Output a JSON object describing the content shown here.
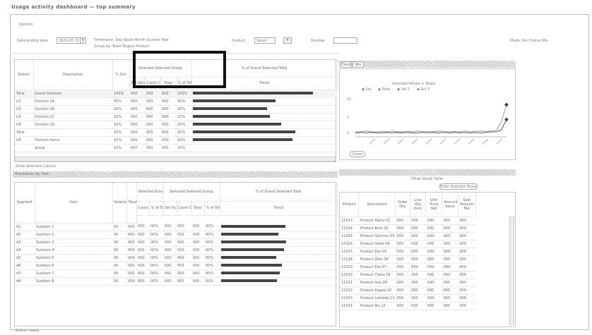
{
  "app": {
    "title": "Usage activity dashboard — top summary"
  },
  "filters": {
    "section_label": "Options",
    "date_label": "Data ending date",
    "date_value": "2021-05-31",
    "radio_row1": "Timeframe: Day  Week  Month  Quarter  Year",
    "radio_row2": "Group by: Team  Region  Product",
    "product_label": "Product",
    "product_value": "Select",
    "number_label": "Number",
    "number_value": "",
    "right_note": "Mode: Per Choice Mix"
  },
  "summary_table": {
    "headers": {
      "col_code": "School",
      "col_desc": "Description",
      "col_pct": "% Sch",
      "group_top": "Selected Selected Group",
      "col_sel": "Sel Values",
      "col_count": "Count Count",
      "col_total": "Total",
      "col_pctof": "% of Total",
      "group_right": "% of Grand Selected Total",
      "col_trend": "Trend"
    },
    "rows": [
      {
        "code": "Total",
        "desc": "Grand Subtotal",
        "pct": "100%",
        "a": "000",
        "b": "000",
        "c": "000",
        "d": "100%",
        "bar": 84
      },
      {
        "code": "U1",
        "desc": "Division 1A",
        "pct": "45%",
        "a": "000",
        "b": "000",
        "c": "000",
        "d": "45%",
        "bar": 58
      },
      {
        "code": "U2",
        "desc": "Division 1B",
        "pct": "20%",
        "a": "000",
        "b": "000",
        "c": "000",
        "d": "20%",
        "bar": 52
      },
      {
        "code": "U3",
        "desc": "Division 1C",
        "pct": "15%",
        "a": "000",
        "b": "000",
        "c": "000",
        "d": "15%",
        "bar": 54
      },
      {
        "code": "U4",
        "desc": "Division 1D",
        "pct": "10%",
        "a": "000",
        "b": "000",
        "c": "000",
        "d": "10%",
        "bar": 62
      },
      {
        "code": "Total",
        "desc": "",
        "pct": "10%",
        "a": "000",
        "b": "000",
        "c": "000",
        "d": "10%",
        "bar": 72
      },
      {
        "code": "U5",
        "desc": "Division Items",
        "pct": "10%",
        "a": "000",
        "b": "000",
        "c": "000",
        "d": "10%",
        "bar": 70
      },
      {
        "code": "",
        "desc": "group",
        "pct": "10%",
        "a": "000",
        "b": "000",
        "c": "000",
        "d": "10%",
        "bar": 0
      }
    ],
    "footer_note": "Show Selected Column"
  },
  "detail_table": {
    "section_title": "Breakdown by item",
    "headers": {
      "col_code": "Segment",
      "col_item": "Item",
      "col_sel": "Selected Sel Count",
      "col_total": "Total",
      "col_count": "Count",
      "group_mid": "Selected Group",
      "col_pct": "% of Total",
      "col_v1": "Sel Values",
      "col_v2": "Count Count",
      "col_v3": "Total",
      "col_v4": "% of Total",
      "group_top": "Selected Selected Group",
      "group_right": "% of Grand Selected Total",
      "col_trend": "Trend"
    },
    "rows": [
      {
        "code": "A1",
        "item": "Subitem 1",
        "s": "00",
        "t": "000",
        "c": "000",
        "p": "00%",
        "v1": "000",
        "v2": "000",
        "v3": "000",
        "v4": "00%",
        "bar": 56
      },
      {
        "code": "A2",
        "item": "Subitem 2",
        "s": "00",
        "t": "000",
        "c": "000",
        "p": "00%",
        "v1": "000",
        "v2": "000",
        "v3": "000",
        "v4": "00%",
        "bar": 50
      },
      {
        "code": "A3",
        "item": "Subitem 3",
        "s": "00",
        "t": "000",
        "c": "000",
        "p": "00%",
        "v1": "000",
        "v2": "000",
        "v3": "000",
        "v4": "00%",
        "bar": 57
      },
      {
        "code": "A4",
        "item": "Subitem 4",
        "s": "00",
        "t": "000",
        "c": "000",
        "p": "00%",
        "v1": "000",
        "v2": "000",
        "v3": "000",
        "v4": "00%",
        "bar": 55
      },
      {
        "code": "A5",
        "item": "Subitem 5",
        "s": "00",
        "t": "000",
        "c": "000",
        "p": "00%",
        "v1": "000",
        "v2": "000",
        "v3": "000",
        "v4": "00%",
        "bar": 48
      },
      {
        "code": "A6",
        "item": "Subitem 6",
        "s": "00",
        "t": "000",
        "c": "000",
        "p": "00%",
        "v1": "000",
        "v2": "000",
        "v3": "000",
        "v4": "00%",
        "bar": 53
      },
      {
        "code": "A7",
        "item": "Subitem 7",
        "s": "00",
        "t": "000",
        "c": "000",
        "p": "00%",
        "v1": "000",
        "v2": "000",
        "v3": "000",
        "v4": "00%",
        "bar": 51
      },
      {
        "code": "A8",
        "item": "Subitem 8",
        "s": "00",
        "t": "000",
        "c": "000",
        "p": "00%",
        "v1": "000",
        "v2": "000",
        "v3": "000",
        "v4": "00%",
        "bar": 49
      }
    ]
  },
  "chart_panel": {
    "tabs": [
      "Trend",
      "Mix"
    ],
    "legend_title": "Selected Values + Totals",
    "legend_items": [
      "Sel",
      "Total",
      "Sel 2",
      "Sel 3"
    ],
    "button": "Zoom",
    "colors": {
      "line1": "#9a9a9a",
      "line2": "#555555",
      "marker": "#3a3a3a"
    }
  },
  "chart_data": {
    "type": "line",
    "x": [
      1,
      2,
      3,
      4,
      5,
      6,
      7,
      8,
      9,
      10,
      11,
      12,
      13,
      14,
      15,
      16,
      17,
      18,
      19,
      20,
      21,
      22,
      23,
      24,
      25,
      26,
      27,
      28,
      29,
      30
    ],
    "series": [
      {
        "values": [
          1,
          1,
          1.2,
          1,
          1,
          1.1,
          1,
          1.2,
          1,
          1,
          1.1,
          1,
          1.2,
          1,
          1.1,
          1,
          1.2,
          1.1,
          1,
          1.1,
          1,
          1.2,
          1,
          1.1,
          1.2,
          1.1,
          1.2,
          1.3,
          3,
          6.5
        ]
      },
      {
        "values": [
          0.8,
          0.9,
          0.8,
          0.9,
          0.8,
          0.8,
          0.9,
          0.8,
          0.9,
          0.8,
          0.9,
          0.8,
          0.8,
          0.9,
          0.8,
          0.9,
          0.8,
          0.9,
          0.8,
          0.9,
          0.8,
          0.9,
          0.8,
          0.9,
          0.8,
          0.9,
          1,
          1,
          1.4,
          3.5
        ]
      }
    ],
    "ylim": [
      0,
      8
    ],
    "yticks": [
      "10",
      "5",
      "0"
    ],
    "grid": false
  },
  "side_table": {
    "title": "Other Detail Table",
    "filter_label": "Filter Selected Totals",
    "headers": [
      "Product",
      "Description",
      "Order Qty",
      "Line Qty Item",
      "Unit Price Net",
      "Amount Value",
      "Sale Amount Net"
    ],
    "rows": [
      {
        "p": "11023",
        "d": "Product Alpha 01",
        "a": "000",
        "b": "000",
        "c": "000",
        "e": "000"
      },
      {
        "p": "11024",
        "d": "Product Beta 02",
        "a": "000",
        "b": "000",
        "c": "000",
        "e": "000"
      },
      {
        "p": "11025",
        "d": "Product Gamma 03",
        "a": "000",
        "b": "000",
        "c": "000",
        "e": "000"
      },
      {
        "p": "11026",
        "d": "Product Delta 04",
        "a": "000",
        "b": "000",
        "c": "000",
        "e": "000"
      },
      {
        "p": "11027",
        "d": "Product Eps 05",
        "a": "000",
        "b": "000",
        "c": "000",
        "e": "000"
      },
      {
        "p": "11028",
        "d": "Product Zeta 06",
        "a": "000",
        "b": "000",
        "c": "000",
        "e": "000"
      },
      {
        "p": "11029",
        "d": "Product Eta 07",
        "a": "000",
        "b": "000",
        "c": "000",
        "e": "000"
      },
      {
        "p": "11030",
        "d": "Product Theta 08",
        "a": "000",
        "b": "000",
        "c": "000",
        "e": "000"
      },
      {
        "p": "11031",
        "d": "Product Iota 09",
        "a": "000",
        "b": "000",
        "c": "000",
        "e": "000"
      },
      {
        "p": "11032",
        "d": "Product Kappa 10",
        "a": "000",
        "b": "000",
        "c": "000",
        "e": "000"
      },
      {
        "p": "11033",
        "d": "Product Lambda 11",
        "a": "000",
        "b": "000",
        "c": "000",
        "e": "000"
      },
      {
        "p": "11034",
        "d": "Product Mu 12",
        "a": "000",
        "b": "000",
        "c": "000",
        "e": "000"
      }
    ]
  },
  "statusbar": {
    "text": "Status: ready"
  }
}
